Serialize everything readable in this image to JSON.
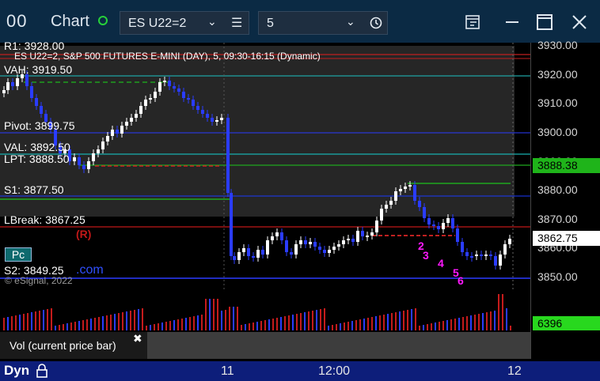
{
  "window": {
    "title": "Chart",
    "symbol": "ES U22=2",
    "interval": "5"
  },
  "study": {
    "header": "ES U22=2, S&P 500 FUTURES E-MINI (DAY), 5, 09:30-16:15 (Dynamic)",
    "copyright": "© eSignal, 2022",
    "pc_button": "Pc",
    "com_label": ".com",
    "break_mark": "(R)"
  },
  "levels": {
    "r1": "R1: 3928.00",
    "vah": "VAH: 3919.50",
    "pivot": "Pivot: 3899.75",
    "val": "VAL: 3892.50",
    "lpt": "LPT: 3888.50",
    "s1": "S1: 3877.50",
    "lbreak": "LBreak: 3867.25",
    "s2": "S2: 3849.25"
  },
  "price_axis": {
    "ticks": [
      "3930.00",
      "3920.00",
      "3910.00",
      "3900.00",
      "3890.00",
      "3880.00",
      "3870.00",
      "3860.00",
      "3850.00"
    ],
    "marker_green": "3888.38",
    "marker_white": "3862.75",
    "vol_marker": "6396"
  },
  "time_axis": {
    "labels": [
      "11",
      "12:00",
      "12"
    ]
  },
  "volume": {
    "label": "Vol (current price bar)",
    "close_glyph": "✖"
  },
  "footer": {
    "dyn": "Dyn"
  },
  "count_labels": [
    "2",
    "3",
    "4",
    "5",
    "6"
  ],
  "colors": {
    "titlebar": "#0b2a44",
    "footer": "#0d1e7a",
    "bull": "#ffffff",
    "bear": "#2a3cff",
    "green_marker": "#22c41c",
    "magenta": "#ff19ff"
  }
}
